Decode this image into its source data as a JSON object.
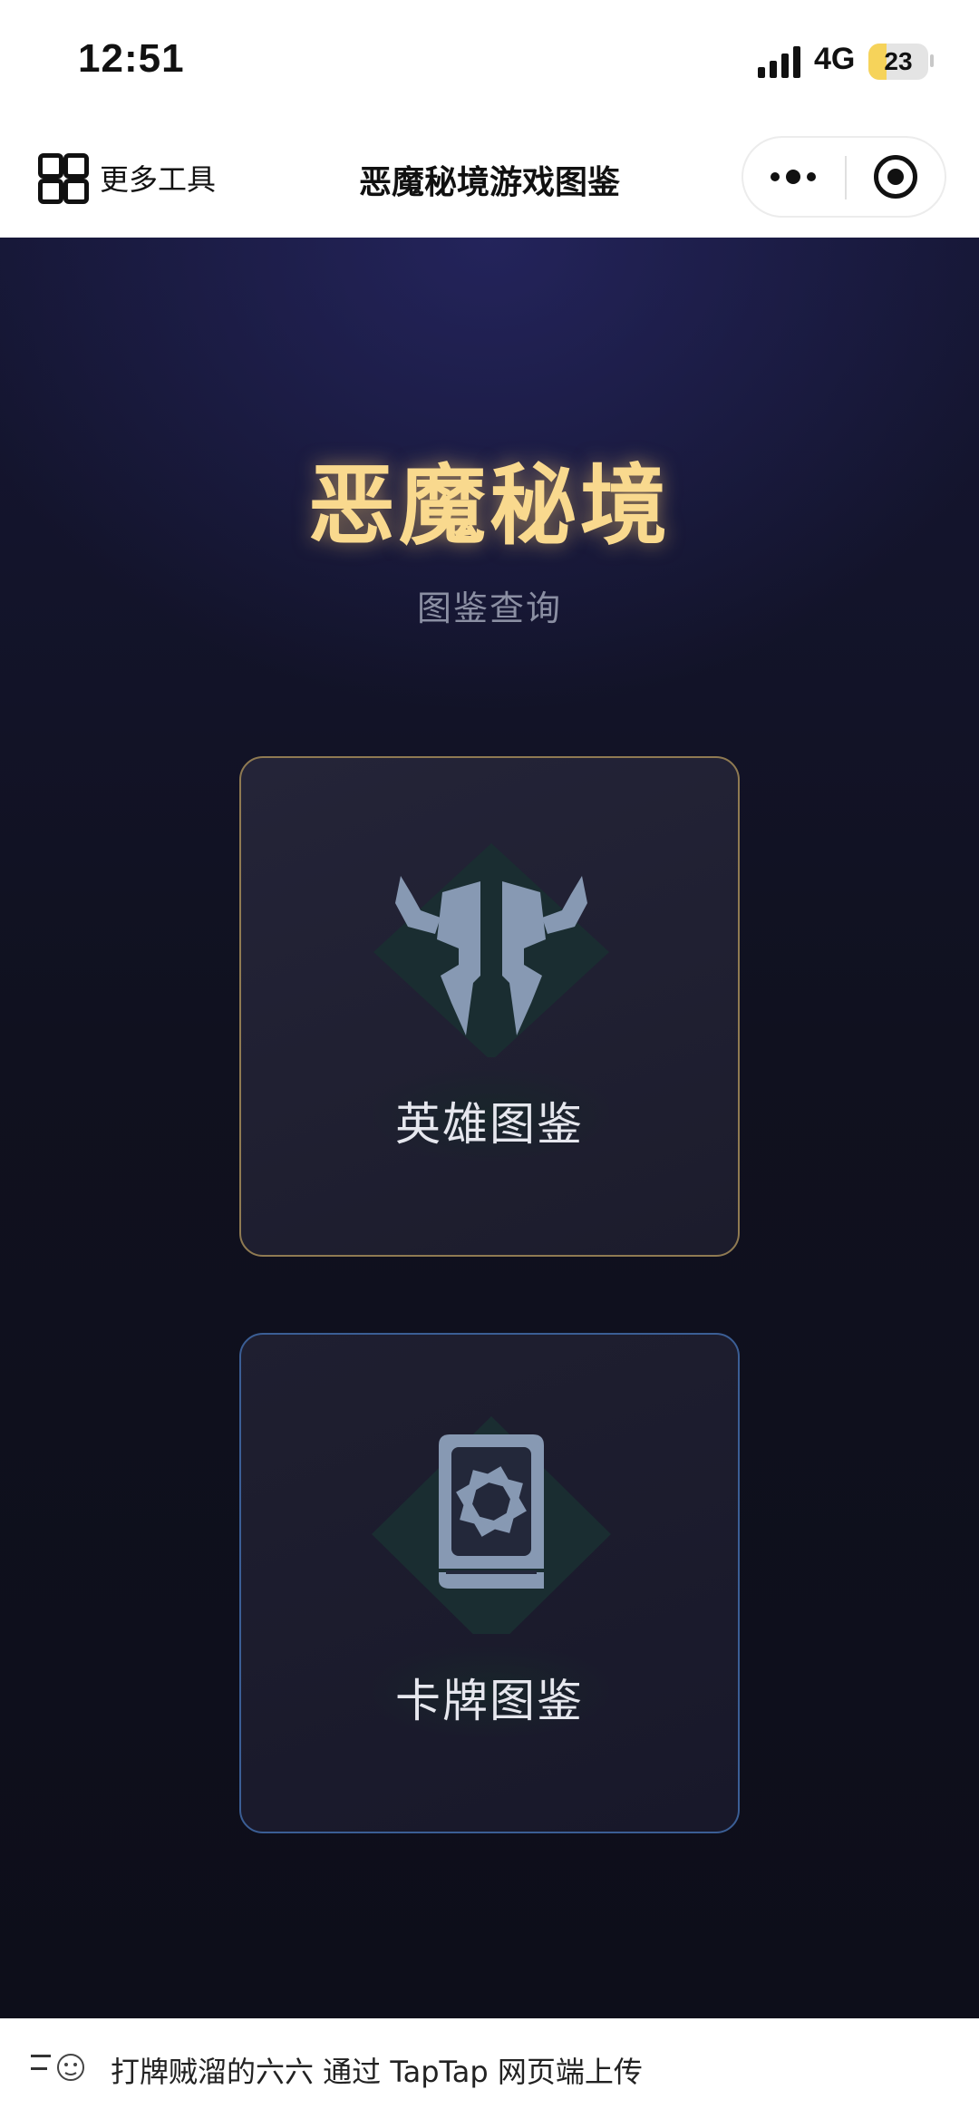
{
  "status_bar": {
    "time": "12:51",
    "network": "4G",
    "battery": "23"
  },
  "nav": {
    "more_tools_label": "更多工具",
    "title": "恶魔秘境游戏图鉴",
    "more_icon": "more-dots-icon",
    "close_icon": "target-close-icon"
  },
  "main": {
    "title": "恶魔秘境",
    "subtitle": "图鉴查询",
    "cards": [
      {
        "label": "英雄图鉴",
        "icon": "horned-helmet-icon",
        "border_color": "#8f7a52"
      },
      {
        "label": "卡牌图鉴",
        "icon": "card-book-icon",
        "border_color": "#3b5e95"
      }
    ],
    "colors": {
      "title": "#f9d98e",
      "background": "#10111f"
    }
  },
  "footer": {
    "text": "打牌贼溜的六六 通过 TapTap 网页端上传",
    "avatar_icon": "avatar-sticker-icon"
  }
}
